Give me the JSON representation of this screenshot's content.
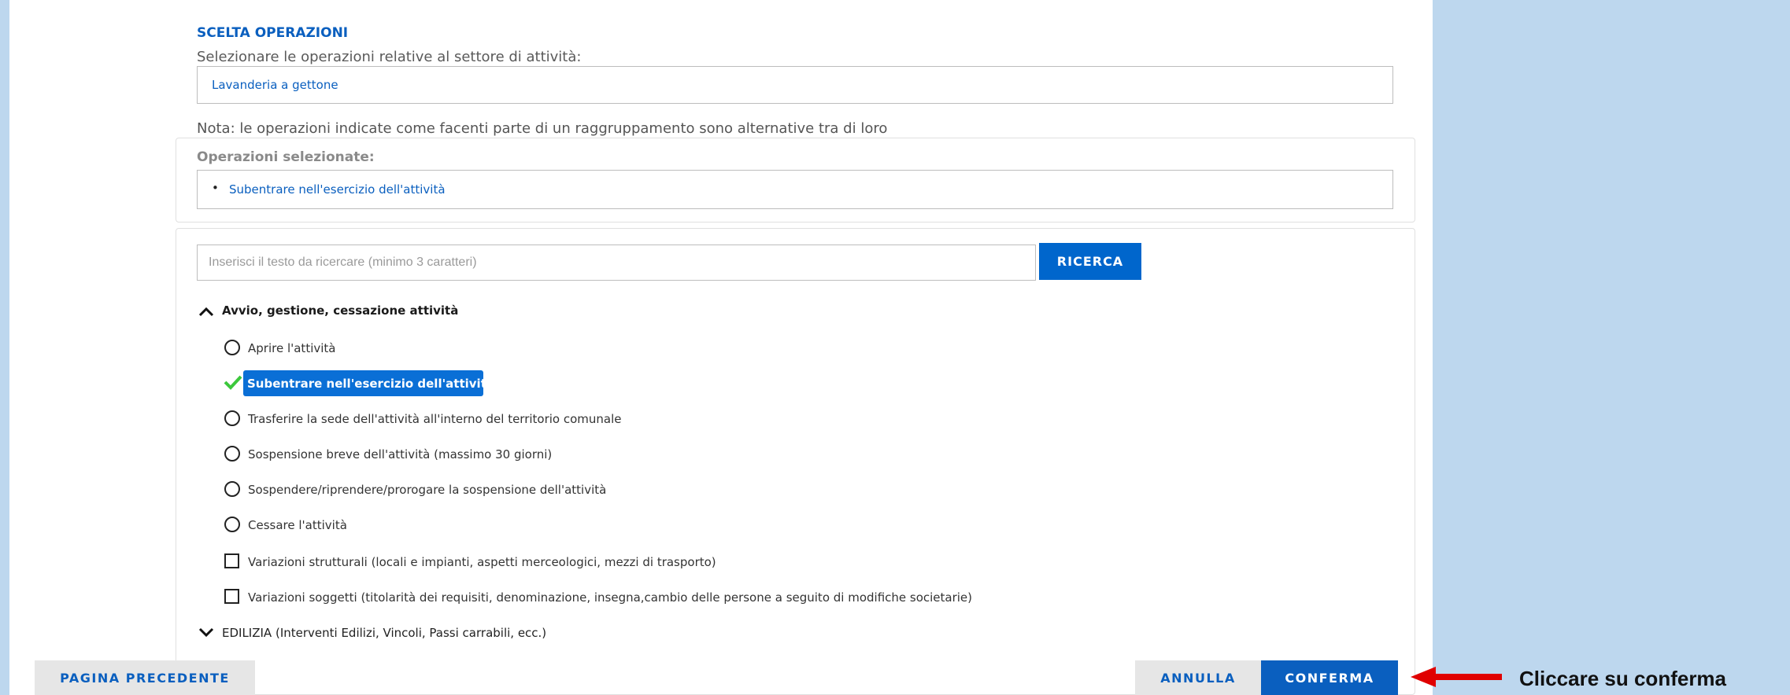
{
  "page": {
    "title": "SCELTA OPERAZIONI",
    "subtitle": "Selezionare le operazioni relative al settore di attività:",
    "sector": "Lavanderia a gettone",
    "note": "Nota: le operazioni indicate come facenti parte di un raggruppamento sono alternative tra di loro"
  },
  "selected": {
    "title": "Operazioni selezionate:",
    "items": [
      "Subentrare nell'esercizio dell'attività"
    ]
  },
  "search": {
    "placeholder": "Inserisci il testo da ricercare (minimo 3 caratteri)",
    "button": "RICERCA"
  },
  "groups": [
    {
      "label": "Avvio, gestione, cessazione attività",
      "expanded": true,
      "operations": [
        {
          "label": "Aprire l'attività",
          "type": "radio",
          "selected": false
        },
        {
          "label": "Subentrare nell'esercizio dell'attività",
          "type": "radio",
          "selected": true
        },
        {
          "label": "Trasferire la sede dell'attività all'interno del territorio comunale",
          "type": "radio",
          "selected": false
        },
        {
          "label": "Sospensione breve dell'attività (massimo 30 giorni)",
          "type": "radio",
          "selected": false
        },
        {
          "label": "Sospendere/riprendere/prorogare la sospensione dell'attività",
          "type": "radio",
          "selected": false
        },
        {
          "label": "Cessare l'attività",
          "type": "radio",
          "selected": false
        },
        {
          "label": "Variazioni strutturali (locali e impianti, aspetti merceologici, mezzi di trasporto)",
          "type": "checkbox",
          "selected": false
        },
        {
          "label": "Variazioni soggetti (titolarità dei requisiti, denominazione, insegna,cambio delle persone a seguito di modifiche societarie)",
          "type": "checkbox",
          "selected": false
        }
      ]
    },
    {
      "label": "EDILIZIA (Interventi Edilizi, Vincoli, Passi carrabili, ecc.)",
      "expanded": false
    }
  ],
  "footer": {
    "prev": "PAGINA PRECEDENTE",
    "cancel": "ANNULLA",
    "confirm": "CONFERMA"
  },
  "callout": "Cliccare su conferma",
  "colors": {
    "accent": "#0066cc",
    "check": "#3cc83c",
    "background": "#bdd7ee",
    "arrow": "#e00000"
  }
}
